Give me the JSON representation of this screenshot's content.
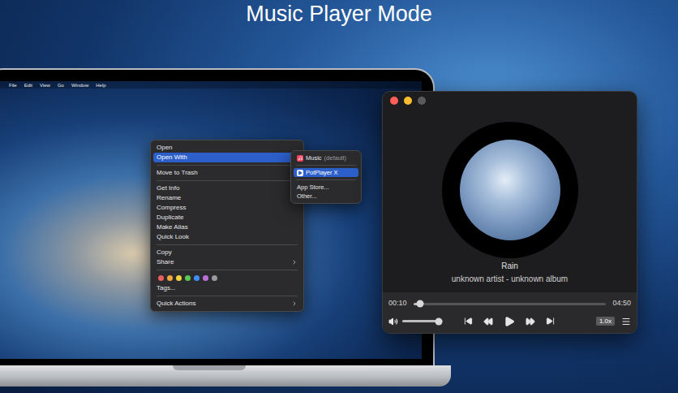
{
  "heading": "Music Player Mode",
  "menu_bar": [
    "File",
    "Edit",
    "View",
    "Go",
    "Window",
    "Help"
  ],
  "context_menu": {
    "items": [
      {
        "kind": "item",
        "label": "Open",
        "selected": false,
        "submenu": false
      },
      {
        "kind": "item",
        "label": "Open With",
        "selected": true,
        "submenu": true
      },
      {
        "kind": "separator"
      },
      {
        "kind": "item",
        "label": "Move to Trash",
        "selected": false,
        "submenu": false
      },
      {
        "kind": "separator"
      },
      {
        "kind": "item",
        "label": "Get Info",
        "selected": false,
        "submenu": false
      },
      {
        "kind": "item",
        "label": "Rename",
        "selected": false,
        "submenu": false
      },
      {
        "kind": "item",
        "label": "Compress",
        "selected": false,
        "submenu": false
      },
      {
        "kind": "item",
        "label": "Duplicate",
        "selected": false,
        "submenu": false
      },
      {
        "kind": "item",
        "label": "Make Alias",
        "selected": false,
        "submenu": false
      },
      {
        "kind": "item",
        "label": "Quick Look",
        "selected": false,
        "submenu": false
      },
      {
        "kind": "separator"
      },
      {
        "kind": "item",
        "label": "Copy",
        "selected": false,
        "submenu": false
      },
      {
        "kind": "item",
        "label": "Share",
        "selected": false,
        "submenu": true
      },
      {
        "kind": "separator"
      },
      {
        "kind": "tags",
        "tags": [
          {
            "color": "#ec5f5c"
          },
          {
            "color": "#f3a63b"
          },
          {
            "color": "#f4d23f"
          },
          {
            "color": "#5cc853"
          },
          {
            "color": "#3f8ef5"
          },
          {
            "color": "#b86fd8"
          },
          {
            "color": "#9a9a9e"
          }
        ]
      },
      {
        "kind": "item",
        "label": "Tags...",
        "selected": false,
        "submenu": false
      },
      {
        "kind": "separator"
      },
      {
        "kind": "item",
        "label": "Quick Actions",
        "selected": false,
        "submenu": true
      }
    ]
  },
  "open_with_menu": {
    "items": [
      {
        "kind": "app",
        "app": "music",
        "label": "Music",
        "note": "(default)",
        "selected": false
      },
      {
        "kind": "separator"
      },
      {
        "kind": "app",
        "app": "potplayer",
        "label": "PotPlayer X",
        "note": "",
        "selected": true
      },
      {
        "kind": "separator"
      },
      {
        "kind": "item",
        "label": "App Store...",
        "selected": false
      },
      {
        "kind": "item",
        "label": "Other...",
        "selected": false
      }
    ]
  },
  "player": {
    "window_buttons": [
      {
        "name": "close",
        "color": "#ff5f57"
      },
      {
        "name": "minimize",
        "color": "#febc2e"
      },
      {
        "name": "zoom",
        "color": "#5b5b5d"
      }
    ],
    "title": "Rain",
    "subtitle": "unknown artist - unknown album",
    "elapsed": "00:10",
    "duration": "04:50",
    "progress": {
      "level": 0.035
    },
    "volume": {
      "level": 0.9
    },
    "playing": false,
    "speed": "1.0x"
  }
}
